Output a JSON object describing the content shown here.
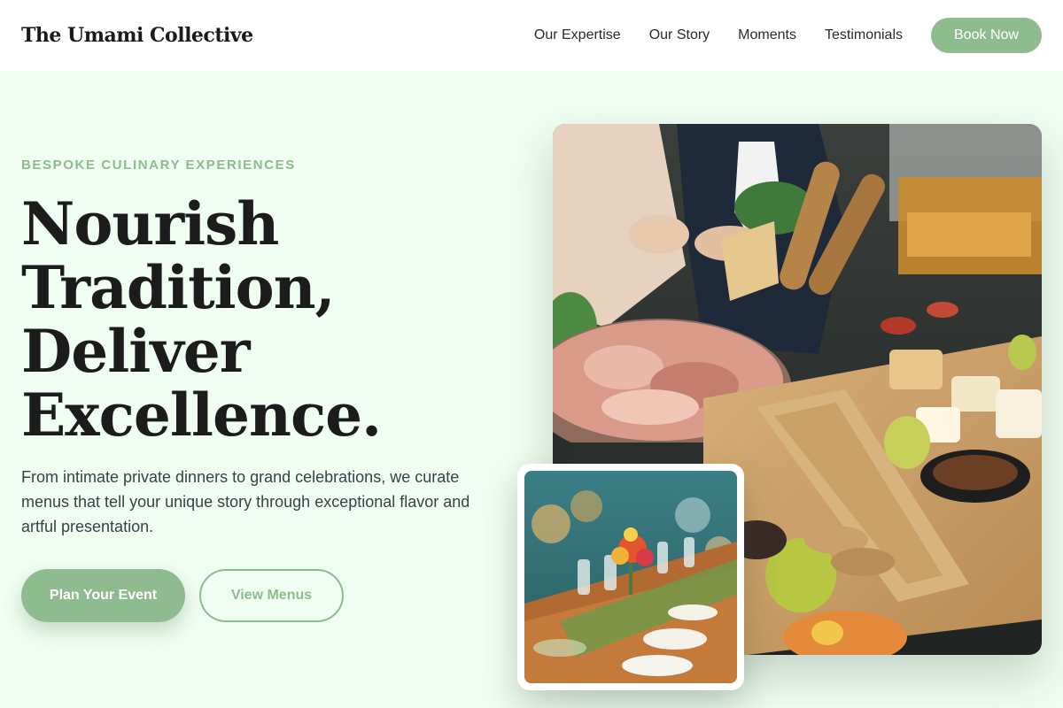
{
  "nav": {
    "brand": "The Umami Collective",
    "links": [
      "Our Expertise",
      "Our Story",
      "Moments",
      "Testimonials"
    ],
    "cta": "Book Now"
  },
  "hero": {
    "eyebrow": "BESPOKE CULINARY EXPERIENCES",
    "headline": [
      "Nourish",
      "Tradition,",
      "Deliver",
      "Excellence."
    ],
    "description": "From intimate private dinners to grand celebrations, we curate menus that tell your unique story through exceptional flavor and artful presentation.",
    "primary_cta": "Plan Your Event",
    "secondary_cta": "View Menus"
  },
  "colors": {
    "accent": "#8fbc8f",
    "background": "#f0fdf2",
    "text": "#1c1c1c"
  }
}
